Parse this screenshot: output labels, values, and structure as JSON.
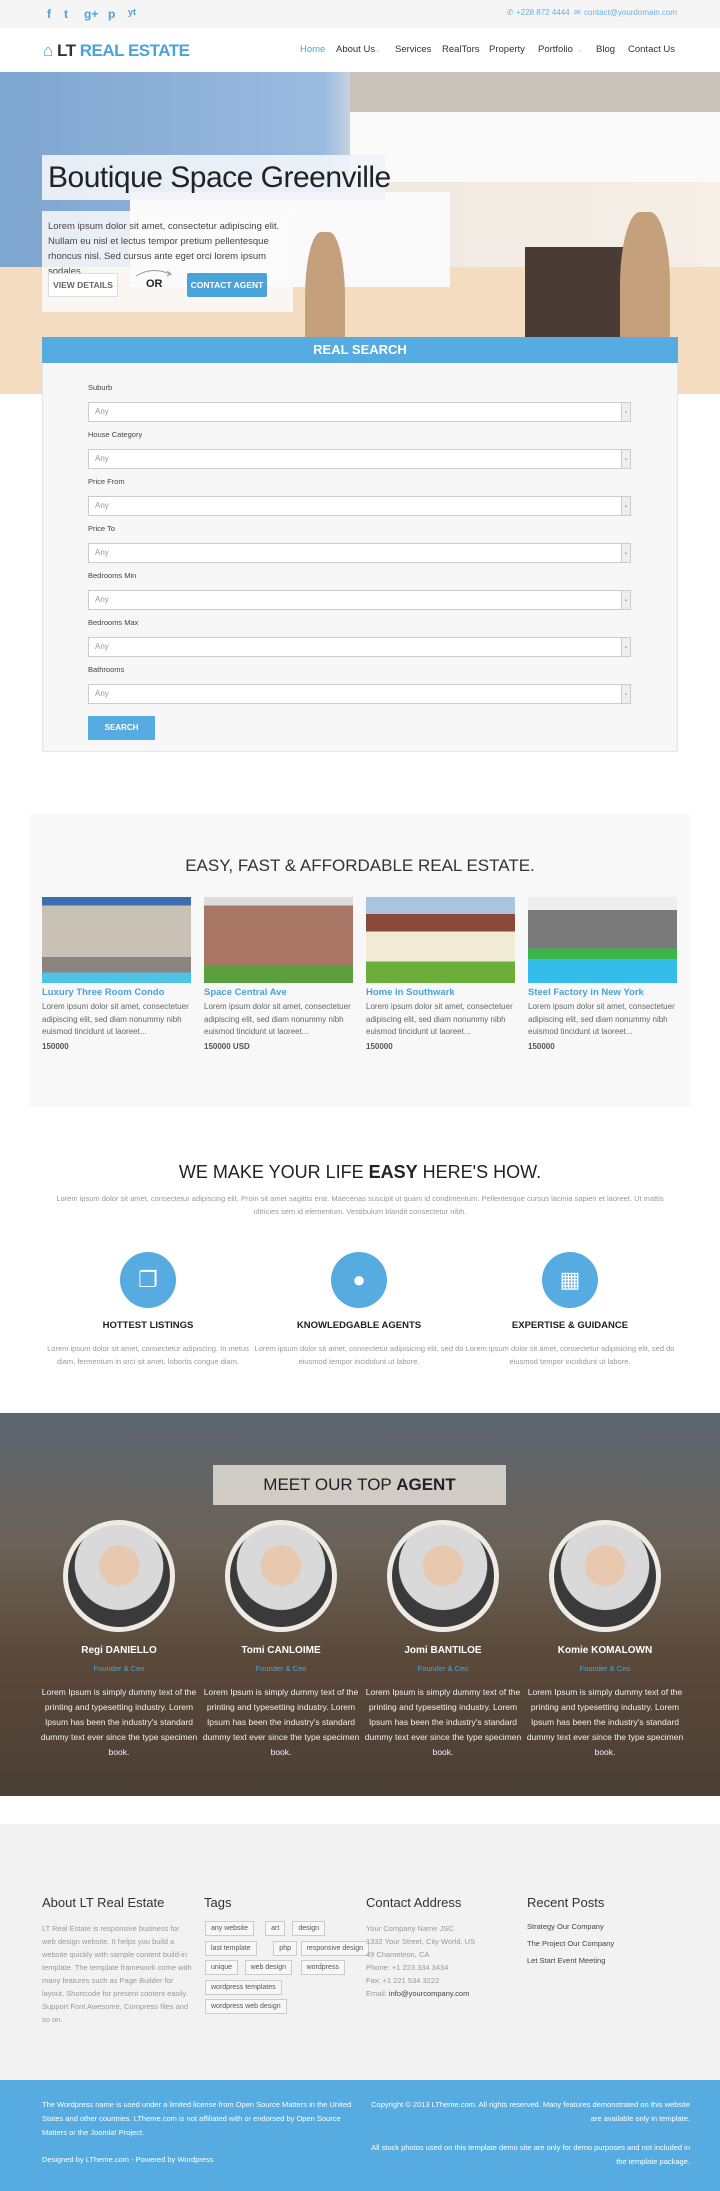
{
  "topbar": {
    "social": [
      "f",
      "t",
      "g+",
      "p",
      "yt"
    ],
    "social_icons": [
      "facebook-icon",
      "twitter-icon",
      "google-plus-icon",
      "pinterest-icon",
      "youtube-icon"
    ],
    "phone": "+228 872 4444",
    "email": "contact@yourdomain.com"
  },
  "nav": {
    "logo_prefix": "LT",
    "logo_main": "REAL ESTATE",
    "items": [
      {
        "label": "Home",
        "active": true
      },
      {
        "label": "About Us",
        "dropdown": true
      },
      {
        "label": "Services"
      },
      {
        "label": "RealTors"
      },
      {
        "label": "Property"
      },
      {
        "label": "Portfolio",
        "dropdown": true
      },
      {
        "label": "Blog"
      },
      {
        "label": "Contact Us"
      }
    ]
  },
  "hero": {
    "title": "Boutique Space Greenville",
    "description": "Lorem ipsum dolor sit amet, consectetur adipiscing elit. Nullam eu nisl et lectus tempor pretium pellentesque rhoncus nisl. Sed cursus ante eget orci lorem ipsum sodales.",
    "view_details": "VIEW DETAILS",
    "or": "OR",
    "contact_agent": "CONTACT AGENT"
  },
  "search": {
    "title": "REAL SEARCH",
    "fields": [
      {
        "label": "Suburb",
        "value": "Any"
      },
      {
        "label": "House Category",
        "value": "Any"
      },
      {
        "label": "Price From",
        "value": "Any"
      },
      {
        "label": "Price To",
        "value": "Any"
      },
      {
        "label": "Bedrooms Min",
        "value": "Any"
      },
      {
        "label": "Bedrooms Max",
        "value": "Any"
      },
      {
        "label": "Bathrooms",
        "value": "Any"
      }
    ],
    "button": "SEARCH"
  },
  "properties": {
    "title": "EASY, FAST & AFFORDABLE REAL ESTATE.",
    "items": [
      {
        "title": "Luxury Three Room Condo",
        "desc": "Lorem ipsum dolor sit amet, consectetuer adipiscing elit, sed diam nonummy nibh euismod tincidunt ut laoreet...",
        "price": "150000"
      },
      {
        "title": "Space Central Ave",
        "desc": "Lorem ipsum dolor sit amet, consectetuer adipiscing elit, sed diam nonummy nibh euismod tincidunt ut laoreet...",
        "price": "150000 USD"
      },
      {
        "title": "Home in Southwark",
        "desc": "Lorem ipsum dolor sit amet, consectetuer adipiscing elit, sed diam nonummy nibh euismod tincidunt ut laoreet...",
        "price": "150000"
      },
      {
        "title": "Steel Factory in New York",
        "desc": "Lorem ipsum dolor sit amet, consectetuer adipiscing elit, sed diam nonummy nibh euismod tincidunt ut laoreet...",
        "price": "150000"
      }
    ]
  },
  "how": {
    "title_pre": "WE MAKE YOUR LIFE ",
    "title_bold": "EASY",
    "title_post": " HERE'S HOW.",
    "desc": "Lorem ipsum dolor sit amet, consectetur adipiscing elit. Proin sit amet sagittis erat. Maecenas suscipit ut quam id condimentum. Pellentesque cursus lacinia sapien et laoreet. Ut mattis ultricies sem id elementum. Vestibulum blandit consectetur nibh.",
    "features": [
      {
        "icon": "documents-icon",
        "title": "HOTTEST LISTINGS",
        "desc": "Lorem ipsum dolor sit amet, consectetur adipiscing. In metus diam, fermentum in orci sit amet, lobortis congue diam."
      },
      {
        "icon": "user-icon",
        "title": "KNOWLEDGABLE AGENTS",
        "desc": "Lorem ipsum dolor sit amet, consectetur adipisicing elit, sed do eiusmod tempor incididunt ut labore."
      },
      {
        "icon": "building-icon",
        "title": "EXPERTISE & GUIDANCE",
        "desc": "Lorem ipsum dolor sit amet, consectetur adipisicing elit, sed do eiusmod tempor incididunt ut labore."
      }
    ]
  },
  "agents": {
    "title_pre": "MEET OUR TOP ",
    "title_bold": "AGENT",
    "items": [
      {
        "name": "Regi DANIELLO",
        "role": "Founder & Ceo",
        "desc": "Lorem Ipsum is simply dummy text of the printing and typesetting industry. Lorem Ipsum has been the industry's standard dummy text ever since the type specimen book."
      },
      {
        "name": "Tomi CANLOIME",
        "role": "Founder & Ceo",
        "desc": "Lorem Ipsum is simply dummy text of the printing and typesetting industry. Lorem Ipsum has been the industry's standard dummy text ever since the type specimen book."
      },
      {
        "name": "Jomi BANTILOE",
        "role": "Founder & Ceo",
        "desc": "Lorem Ipsum is simply dummy text of the printing and typesetting industry. Lorem Ipsum has been the industry's standard dummy text ever since the type specimen book."
      },
      {
        "name": "Komie KOMALOWN",
        "role": "Founder & Ceo",
        "desc": "Lorem Ipsum is simply dummy text of the printing and typesetting industry. Lorem Ipsum has been the industry's standard dummy text ever since the type specimen book."
      }
    ]
  },
  "footer": {
    "about_title": "About LT Real Estate",
    "about_text": "LT Real Estate is responsive business for web design website. It helps you build a website quickly with sample content build-in template. The template framework come with many features such as Page Builder for layout, Shortcode for present content easily. Support Font Awesome, Compress files and so on.",
    "tags_title": "Tags",
    "tags": [
      "any website",
      "art",
      "design",
      "last template",
      "php",
      "responsive design",
      "unique",
      "web design",
      "wordpress",
      "wordpress templates",
      "wordpress web design"
    ],
    "contact_title": "Contact Address",
    "contact_lines": [
      "Your Company Name JSC",
      "1332 Your Street, City World, US",
      "49 Chameleon, CA",
      "Phone: +1 223 334 3434",
      "Fax: +1 221 534 3222"
    ],
    "email_label": "Email: ",
    "email": "info@yourcompany.com",
    "posts_title": "Recent Posts",
    "posts": [
      "Strategy Our Company",
      "The Project Our Company",
      "Let Start Event Meeting"
    ],
    "legal": "The Wordpress name is used under a limited license from Open Source Matters in the United States and other countries. LTheme.com is not affiliated with or endorsed by Open Source Matters or the Joomla! Project.",
    "designed": "Designed by LTheme.com - Powered by Wordpress",
    "copyright": "Copyright © 2013 LTheme.com. All rights reserved. Many features demonstrated on this website are available only in template.",
    "stock": "All stock photos used on this template demo site are only for demo purposes and not included in the template package."
  },
  "colors": {
    "accent": "#56abe0",
    "link": "#4aa3d9"
  }
}
